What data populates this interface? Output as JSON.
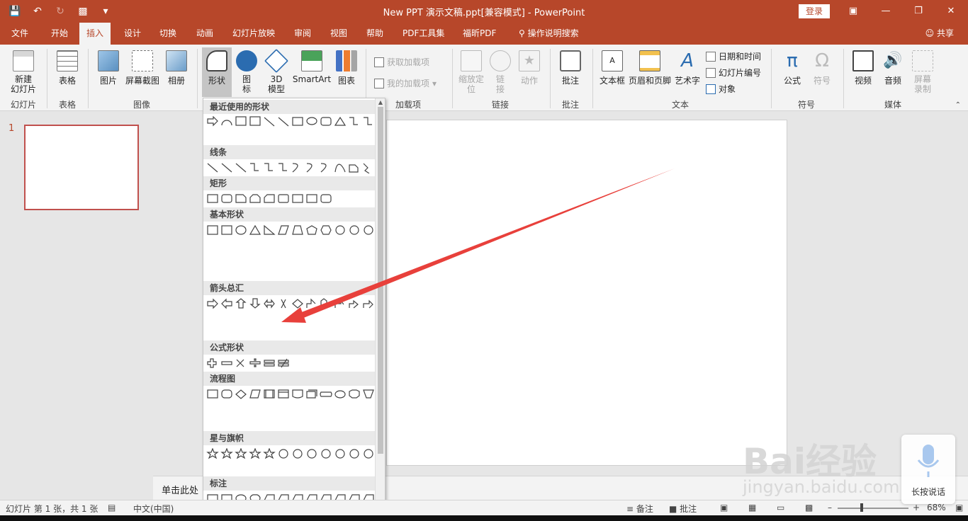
{
  "window": {
    "title": "New PPT 演示文稿.ppt[兼容模式]  -  PowerPoint",
    "login": "登录"
  },
  "tabs": [
    "文件",
    "开始",
    "插入",
    "设计",
    "切换",
    "动画",
    "幻灯片放映",
    "审阅",
    "视图",
    "帮助",
    "PDF工具集",
    "福昕PDF",
    "操作说明搜索"
  ],
  "active_tab": "插入",
  "share": "共享",
  "ribbon": {
    "new_slide": "新建\n幻灯片",
    "table": "表格",
    "picture": "图片",
    "screenshot": "屏幕截图",
    "album": "相册",
    "shapes": "形状",
    "icons": "图\n标",
    "model3d": "3D\n模型",
    "smartart": "SmartArt",
    "chart": "图表",
    "get_addins": "获取加载项",
    "my_addins": "我的加载项",
    "zoom": "缩放定\n位",
    "link": "链\n接",
    "action": "动作",
    "comment": "批注",
    "textbox": "文本框",
    "header_footer": "页眉和页脚",
    "wordart": "艺术字",
    "datetime": "日期和时间",
    "slide_number": "幻灯片编号",
    "object": "对象",
    "equation": "公式",
    "symbol": "符号",
    "video": "视频",
    "audio": "音频",
    "screen_record": "屏幕\n录制",
    "groups": {
      "slides": "幻灯片",
      "tables": "表格",
      "images": "图像",
      "addins": "加载项",
      "links": "链接",
      "comments": "批注",
      "text": "文本",
      "symbols": "符号",
      "media": "媒体"
    }
  },
  "shapes_gallery": {
    "sections": [
      "最近使用的形状",
      "线条",
      "矩形",
      "基本形状",
      "箭头总汇",
      "公式形状",
      "流程图",
      "星与旗帜",
      "标注"
    ]
  },
  "thumb_number": "1",
  "notes_placeholder": "单击此处",
  "status": {
    "slide_info": "幻灯片 第 1 张，共 1 张",
    "language": "中文(中国)",
    "notes": "备注",
    "comments": "批注",
    "zoom": "68%"
  },
  "watermark": {
    "logo": "Bai经验",
    "url": "jingyan.baidu.com"
  },
  "voice_input": "长按说话",
  "colors": {
    "brand": "#b7472a",
    "arrow": "#e8403b"
  }
}
